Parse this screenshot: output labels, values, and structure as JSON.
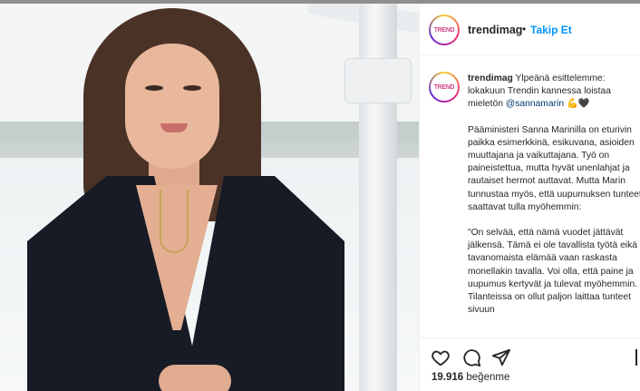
{
  "post": {
    "username": "trendimag",
    "dot": "•",
    "follow_label": "Takip Et",
    "avatar_text": "TREND",
    "caption": {
      "username": "trendimag",
      "intro": "Ylpeänä esittelemme: lokakuun Trendin kannessa loistaa mieletön",
      "mention": "@sannamarin",
      "emojis": "💪🖤",
      "paragraph1": "Pääministeri Sanna Marinilla on eturivin paikka esimerkkinä, esikuvana, asioiden muuttajana ja vaikuttajana. Työ on paineistettua, mutta hyvät unenlahjat ja rautaiset hermot auttavat. Mutta Marin tunnustaa myös, että uupumuksen tunteet saattavat tulla myöhemmin:",
      "paragraph2": "\"On selvää, että nämä vuodet jättävät jälkensä. Tämä ei ole tavallista työtä eikä tavanomaista elämää vaan raskasta monellakin tavalla. Voi olla, että paine ja uupumus kertyvät ja tulevat myöhemmin. Tilanteissa on ollut paljon laittaa tunteet sivuun"
    },
    "likes_count": "19.916",
    "likes_label": "beğenme"
  },
  "icons": {
    "like": "heart-icon",
    "comment": "comment-icon",
    "share": "share-icon",
    "save": "bookmark-icon"
  },
  "colors": {
    "follow": "#0095f6",
    "mention": "#00376b",
    "text": "#262626"
  }
}
